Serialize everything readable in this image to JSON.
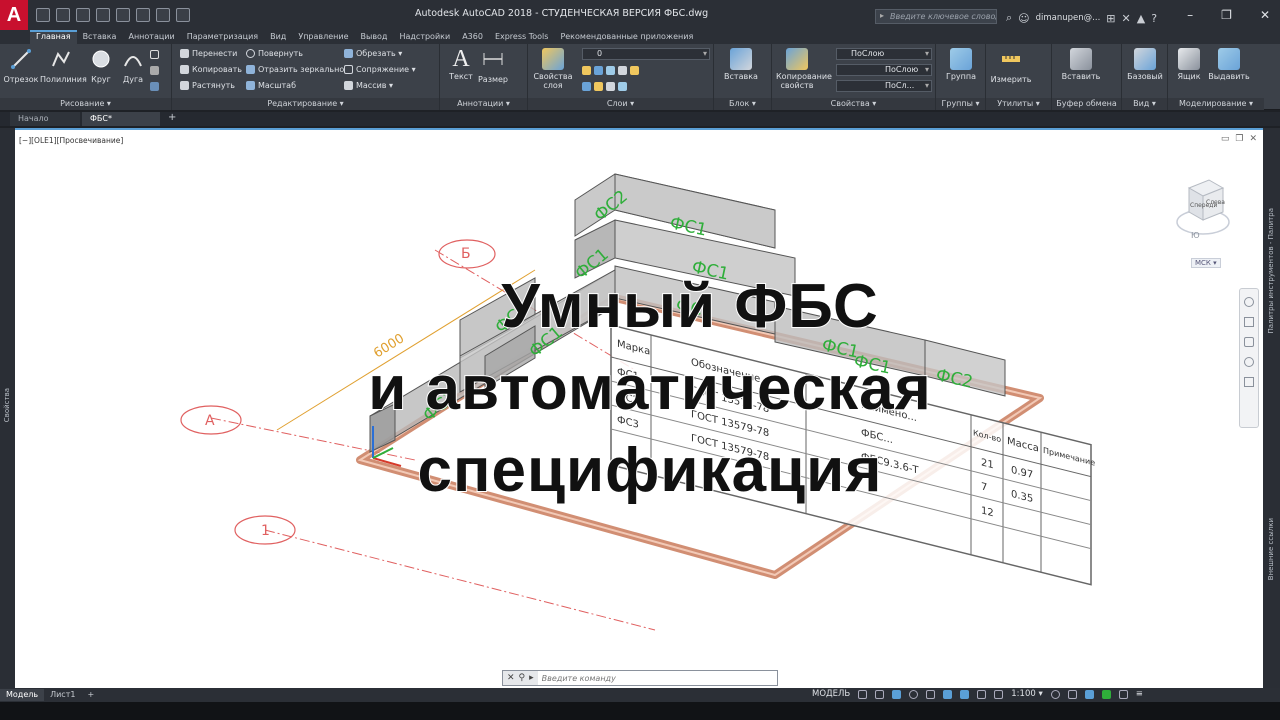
{
  "titlebar": {
    "app_logo": "A",
    "window_title": "Autodesk AutoCAD 2018 - СТУДЕНЧЕСКАЯ ВЕРСИЯ    ФБС.dwg",
    "search_placeholder": "Введите ключевое слово/фразу",
    "user_name": "dimanupen@...",
    "controls": [
      "–",
      "❐",
      "✕"
    ]
  },
  "ribbon_tabs": [
    "Главная",
    "Вставка",
    "Аннотации",
    "Параметризация",
    "Вид",
    "Управление",
    "Вывод",
    "Надстройки",
    "A360",
    "Express Tools",
    "Рекомендованные приложения"
  ],
  "ribbon": {
    "draw": {
      "title": "Рисование ▾",
      "tools": [
        "Отрезок",
        "Полилиния",
        "Круг",
        "Дуга"
      ]
    },
    "modify": {
      "title": "Редактирование ▾",
      "rows": [
        [
          "Перенести",
          "Повернуть",
          "Обрезать ▾"
        ],
        [
          "Копировать",
          "Отразить зеркально",
          "Сопряжение ▾"
        ],
        [
          "Растянуть",
          "Масштаб",
          "Массив ▾"
        ]
      ]
    },
    "annotation": {
      "title": "Аннотации ▾",
      "tools": [
        "Текст",
        "Размер"
      ]
    },
    "layers": {
      "title": "Слои ▾",
      "tool": "Свойства слоя",
      "current_layer": "0"
    },
    "block": {
      "title": "Блок ▾",
      "tool": "Вставка"
    },
    "properties": {
      "title": "Свойства ▾",
      "tool": "Копирование свойств",
      "color": "ПоСлою",
      "linetype": "ПоСлою",
      "lineweight": "ПоСл..."
    },
    "groups": {
      "title": "Группы ▾",
      "tool": "Группа"
    },
    "utilities": {
      "title": "Утилиты ▾",
      "tool": "Измерить"
    },
    "clipboard": {
      "title": "Буфер обмена",
      "tool": "Вставить"
    },
    "view": {
      "title": "Вид ▾",
      "tool": "Базовый"
    },
    "modeling": {
      "title": "Моделирование ▾",
      "tools": [
        "Ящик",
        "Выдавить"
      ]
    }
  },
  "file_tabs": [
    "Начало",
    "ФБС*"
  ],
  "side_rails": {
    "left": "Свойства",
    "right_top": "Палитры инструментов - Палитра",
    "right_bottom": "Внешние ссылки"
  },
  "viewport": {
    "label": "[−][OLE1][Просвечивание]",
    "viewcube_face": "Спереди",
    "viewcube_side": "Слева",
    "compass_letter": "Ю",
    "wcs": "МСК ▾"
  },
  "drawing": {
    "block_labels": [
      "ФС2",
      "ФС1",
      "ФС1",
      "ФС1",
      "ФС1",
      "ФС2",
      "ФС1",
      "ФС1",
      "ФС1",
      "ФС1",
      "ФС2"
    ],
    "axis_labels": [
      "Б",
      "А",
      "1"
    ],
    "dimension": "6000",
    "table": {
      "headers": [
        "Марка",
        "Обозначение",
        "Наимено...",
        "Кол-во",
        "Масса",
        "Примечание"
      ],
      "rows": [
        [
          "ФС1",
          "ГОСТ 13579-78",
          "ФБС...",
          "21",
          "0.97",
          ""
        ],
        [
          "ФС2",
          "ГОСТ 13579-78",
          "ФБС9.3.6-Т",
          "7",
          "0.35",
          ""
        ],
        [
          "ФС3",
          "ГОСТ 13579-78",
          "",
          "12",
          "",
          ""
        ]
      ]
    }
  },
  "headline": [
    "Умный ФБС",
    "и автоматическая",
    "спецификация"
  ],
  "cmdline": {
    "placeholder": "Введите команду"
  },
  "statusbar": {
    "tabs": [
      "Модель",
      "Лист1"
    ],
    "model_label": "МОДЕЛЬ",
    "scale": "1:100 ▾"
  },
  "colors": {
    "accent": "#5a9fd6",
    "block_label": "#2fae3a",
    "slab": "#c97a5a",
    "block_fill": "#b9b9b9",
    "logo": "#c8102e"
  }
}
